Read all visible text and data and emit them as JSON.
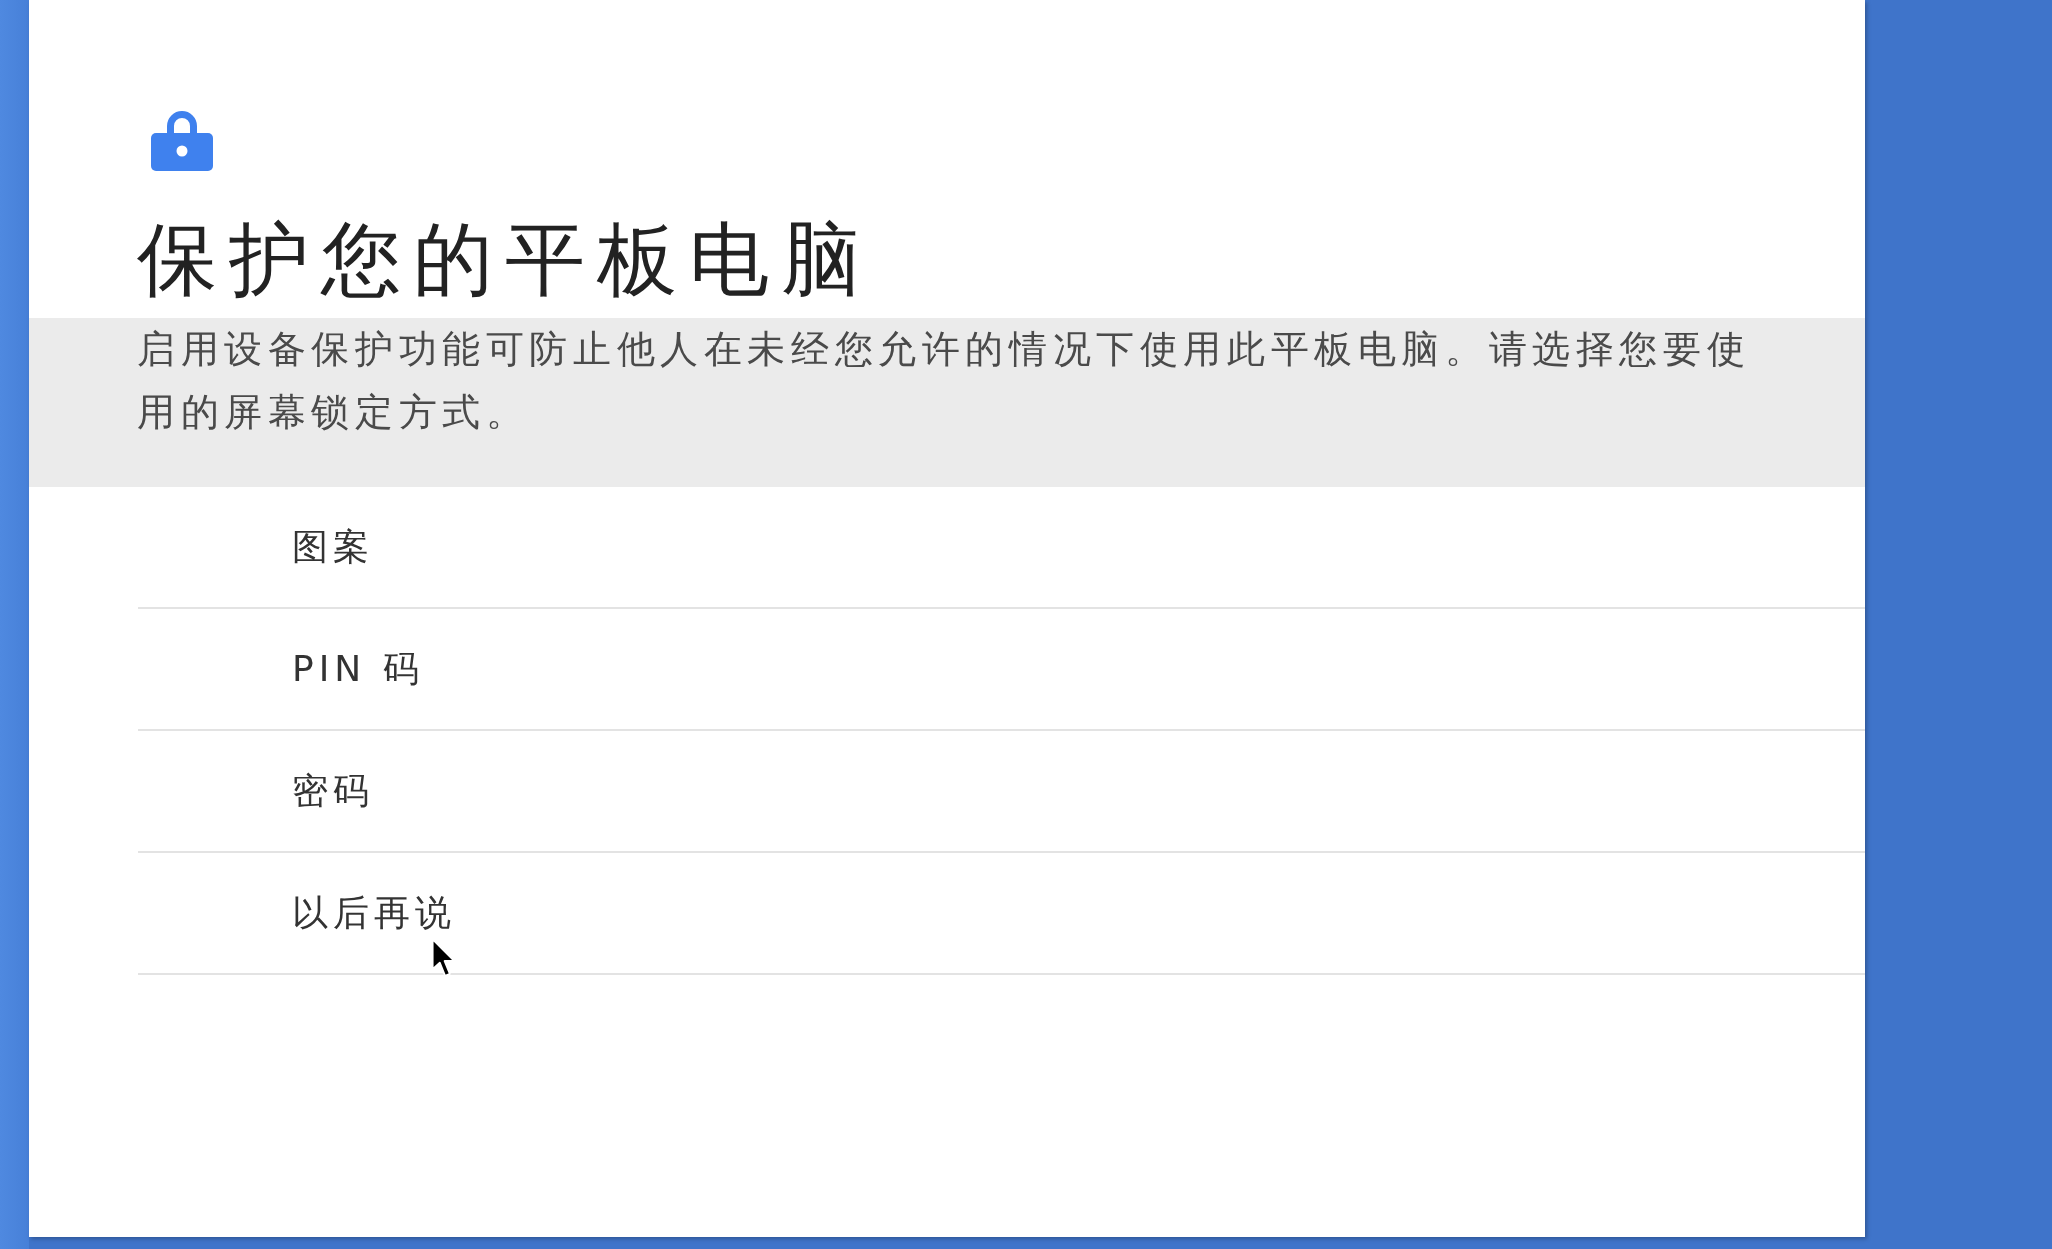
{
  "page": {
    "title": "保护您的平板电脑",
    "description": "启用设备保护功能可防止他人在未经您允许的情况下使用此平板电脑。请选择您要使用的屏幕锁定方式。"
  },
  "options": [
    {
      "label": "图案"
    },
    {
      "label": "PIN 码"
    },
    {
      "label": "密码"
    },
    {
      "label": "以后再说"
    }
  ]
}
